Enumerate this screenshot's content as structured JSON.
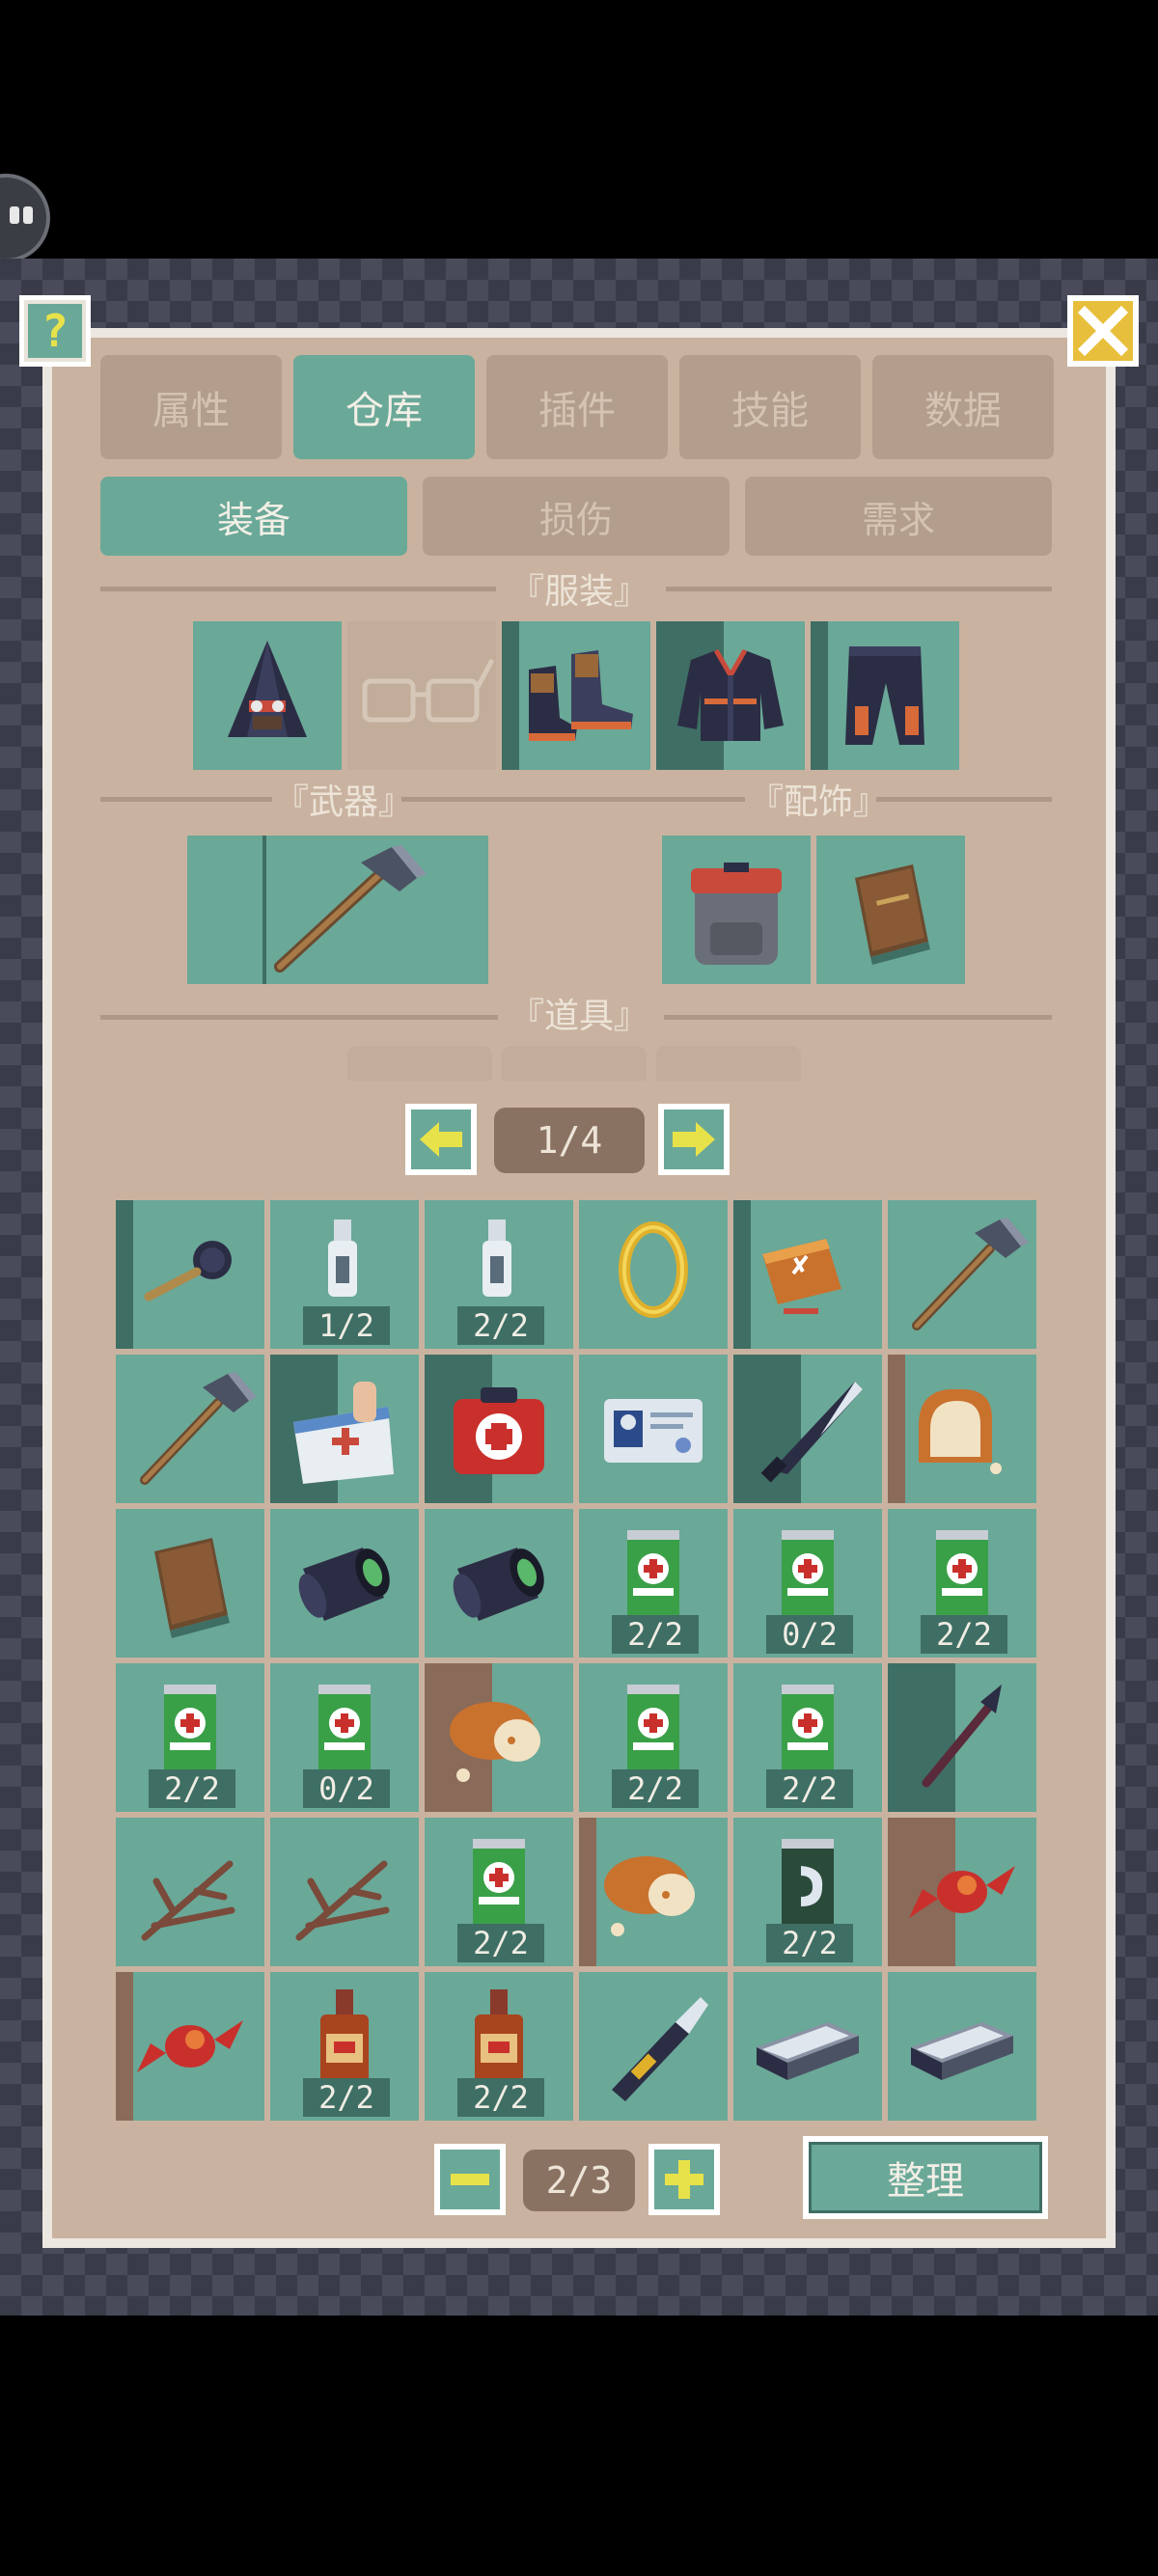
{
  "tabs": [
    {
      "label": "属性",
      "active": false
    },
    {
      "label": "仓库",
      "active": true
    },
    {
      "label": "插件",
      "active": false
    },
    {
      "label": "技能",
      "active": false
    },
    {
      "label": "数据",
      "active": false
    }
  ],
  "subtabs": [
    {
      "label": "装备",
      "active": true
    },
    {
      "label": "损伤",
      "active": false
    },
    {
      "label": "需求",
      "active": false
    }
  ],
  "sections": {
    "clothing": "『服装』",
    "weapons": "『武器』",
    "accessories": "『配饰』",
    "items": "『道具』"
  },
  "top_buttons": {
    "help_glyph": "?",
    "close_icon": "close-icon"
  },
  "clothing_slots": [
    {
      "icon": "hood-icon",
      "filled": true
    },
    {
      "icon": "glasses-icon",
      "filled": false
    },
    {
      "icon": "boots-icon",
      "filled": true
    },
    {
      "icon": "jacket-icon",
      "filled": true
    },
    {
      "icon": "pants-icon",
      "filled": true
    }
  ],
  "weapon_slot": {
    "icon": "hammer-icon"
  },
  "accessory_slots": [
    {
      "icon": "backpack-icon"
    },
    {
      "icon": "book-icon"
    }
  ],
  "pager_top": {
    "label": "1/4",
    "prev_icon": "arrow-left-icon",
    "next_icon": "arrow-right-icon"
  },
  "inventory": [
    {
      "icon": "frying-pan-icon",
      "count": ""
    },
    {
      "icon": "empty-bottle-icon",
      "count": "1/2"
    },
    {
      "icon": "empty-bottle-icon",
      "count": "2/2"
    },
    {
      "icon": "ring-icon",
      "count": ""
    },
    {
      "icon": "matchbox-icon",
      "count": ""
    },
    {
      "icon": "hammer-icon",
      "count": ""
    },
    {
      "icon": "hammer-icon",
      "count": ""
    },
    {
      "icon": "medical-box-icon",
      "count": ""
    },
    {
      "icon": "first-aid-kit-icon",
      "count": ""
    },
    {
      "icon": "id-card-icon",
      "count": ""
    },
    {
      "icon": "machete-icon",
      "count": ""
    },
    {
      "icon": "bread-icon",
      "count": ""
    },
    {
      "icon": "book-icon",
      "count": ""
    },
    {
      "icon": "lens-icon",
      "count": ""
    },
    {
      "icon": "lens-icon",
      "count": ""
    },
    {
      "icon": "green-can-icon",
      "count": "2/2"
    },
    {
      "icon": "green-can-icon",
      "count": "0/2"
    },
    {
      "icon": "green-can-icon",
      "count": "2/2"
    },
    {
      "icon": "green-can-icon",
      "count": "2/2"
    },
    {
      "icon": "green-can-icon",
      "count": "0/2"
    },
    {
      "icon": "meat-icon",
      "count": ""
    },
    {
      "icon": "green-can-icon",
      "count": "2/2"
    },
    {
      "icon": "green-can-icon",
      "count": "2/2"
    },
    {
      "icon": "spear-tip-icon",
      "count": ""
    },
    {
      "icon": "twigs-icon",
      "count": ""
    },
    {
      "icon": "twigs-icon",
      "count": ""
    },
    {
      "icon": "green-can-icon",
      "count": "2/2"
    },
    {
      "icon": "meat-icon",
      "count": ""
    },
    {
      "icon": "energy-can-icon",
      "count": "2/2"
    },
    {
      "icon": "candy-icon",
      "count": ""
    },
    {
      "icon": "candy-icon",
      "count": ""
    },
    {
      "icon": "liquor-bottle-icon",
      "count": "2/2"
    },
    {
      "icon": "liquor-bottle-icon",
      "count": "2/2"
    },
    {
      "icon": "utility-knife-icon",
      "count": ""
    },
    {
      "icon": "metal-bar-icon",
      "count": ""
    },
    {
      "icon": "metal-bar-icon",
      "count": ""
    }
  ],
  "pager_bottom": {
    "label": "2/3",
    "minus_icon": "minus-icon",
    "plus_icon": "plus-icon"
  },
  "sort_button": {
    "label": "整理"
  },
  "colors": {
    "teal": "#6aa898",
    "dark_teal": "#3f6e64",
    "panel": "#c9b3a0",
    "accent_yellow": "#e8e24a"
  }
}
